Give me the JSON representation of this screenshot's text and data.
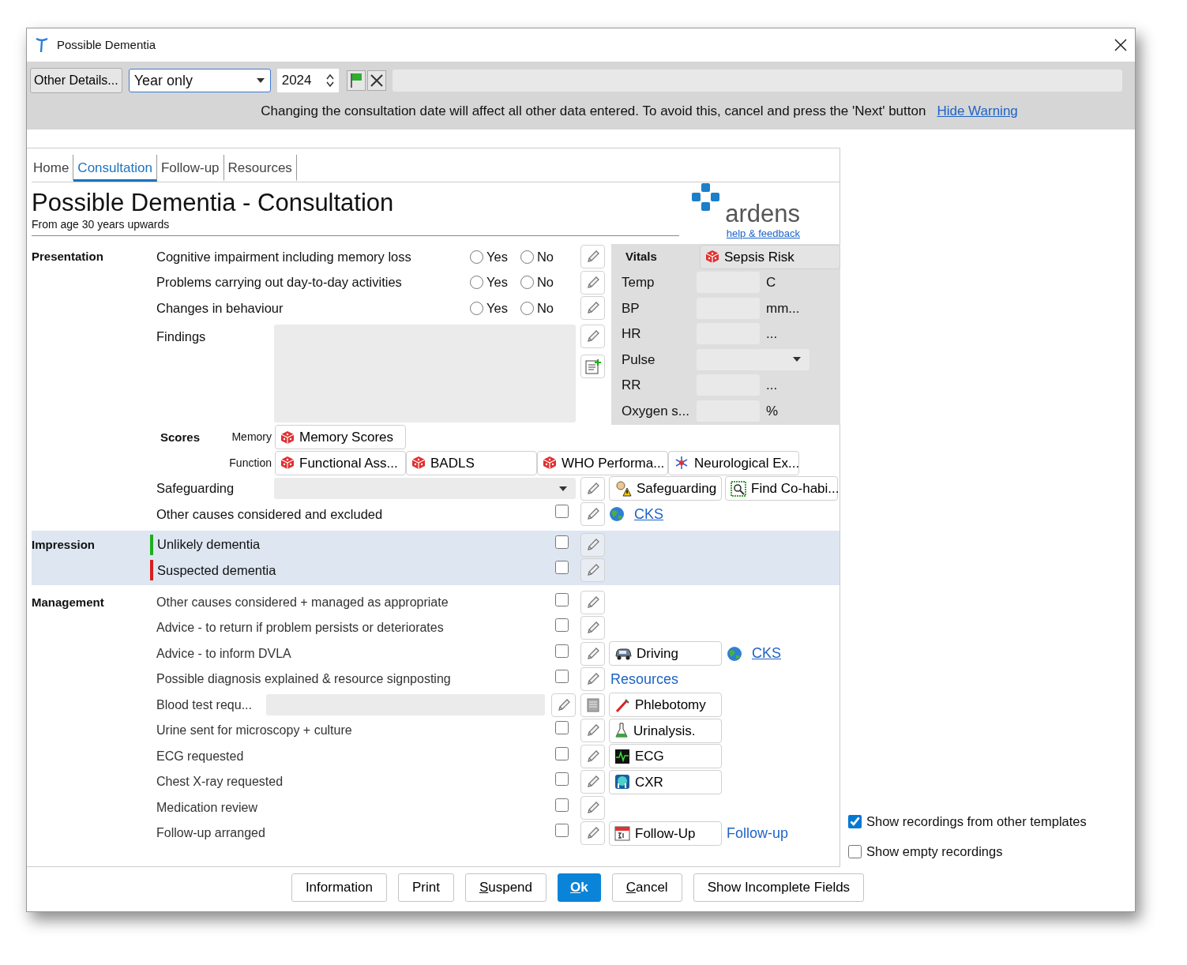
{
  "window": {
    "title": "Possible Dementia"
  },
  "toolbar": {
    "other_details": "Other Details...",
    "date_mode": "Year only",
    "year": "2024"
  },
  "warning": {
    "text": "Changing the consultation date will affect all other data entered. To avoid this, cancel and press the 'Next' button",
    "link": "Hide Warning"
  },
  "tabs": [
    {
      "label": "Home",
      "selected": false
    },
    {
      "label": "Consultation",
      "selected": true
    },
    {
      "label": "Follow-up",
      "selected": false
    },
    {
      "label": "Resources",
      "selected": false
    }
  ],
  "header": {
    "title": "Possible Dementia - Consultation",
    "subtitle": "From age 30 years upwards",
    "logo_text": "ardens",
    "help_link": "help & feedback"
  },
  "presentation": {
    "heading": "Presentation",
    "questions": [
      {
        "label": "Cognitive impairment including memory loss",
        "options": [
          {
            "label": "Yes",
            "selected": false
          },
          {
            "label": "No",
            "selected": false
          }
        ]
      },
      {
        "label": "Problems carrying out day-to-day activities",
        "options": [
          {
            "label": "Yes",
            "selected": false
          },
          {
            "label": "No",
            "selected": false
          }
        ]
      },
      {
        "label": "Changes in behaviour",
        "options": [
          {
            "label": "Yes",
            "selected": false
          },
          {
            "label": "No",
            "selected": false
          }
        ]
      }
    ],
    "findings": {
      "label": "Findings"
    }
  },
  "vitals": {
    "heading": "Vitals",
    "sepsis_button": "Sepsis Risk",
    "rows": [
      {
        "label": "Temp",
        "kind": "field",
        "unit": "C"
      },
      {
        "label": "BP",
        "kind": "field",
        "unit": "mm..."
      },
      {
        "label": "HR",
        "kind": "field",
        "unit": "..."
      },
      {
        "label": "Pulse",
        "kind": "select"
      },
      {
        "label": "RR",
        "kind": "field",
        "unit": "..."
      },
      {
        "label": "Oxygen s...",
        "kind": "field",
        "unit": "%"
      }
    ]
  },
  "scores": {
    "heading": "Scores",
    "groups": [
      {
        "label": "Memory",
        "buttons": [
          "Memory Scores"
        ]
      },
      {
        "label": "Function",
        "buttons": [
          "Functional Ass...",
          "BADLS",
          "WHO Performa...",
          "Neurological Ex..."
        ]
      }
    ]
  },
  "other_rows": [
    {
      "label": "Safeguarding",
      "kind": "select",
      "actions": [
        {
          "kind": "button",
          "label": "Safeguarding"
        },
        {
          "kind": "button",
          "label": "Find Co-habi..."
        }
      ]
    },
    {
      "label": "Other causes considered and excluded",
      "kind": "check",
      "checked": false,
      "actions": [
        {
          "kind": "web-link",
          "label": "CKS"
        }
      ]
    }
  ],
  "impression": {
    "heading": "Impression",
    "rows": [
      {
        "label": "Unlikely dementia",
        "color": "#1fae1f",
        "checked": false
      },
      {
        "label": "Suspected dementia",
        "color": "#d81e1e",
        "checked": false
      }
    ]
  },
  "management": {
    "heading": "Management",
    "rows": [
      {
        "label": "Other causes considered + managed as appropriate",
        "kind": "check",
        "checked": false,
        "actions": []
      },
      {
        "label": "Advice - to return if problem persists or deteriorates",
        "kind": "check",
        "checked": false,
        "actions": []
      },
      {
        "label": "Advice - to inform DVLA",
        "kind": "check",
        "checked": false,
        "actions": [
          {
            "kind": "button",
            "label": "Driving"
          },
          {
            "kind": "web-link",
            "label": "CKS"
          }
        ]
      },
      {
        "label": "Possible diagnosis explained & resource signposting",
        "kind": "check",
        "checked": false,
        "actions": [
          {
            "kind": "link",
            "label": "Resources"
          }
        ]
      },
      {
        "label": "Blood test requ...",
        "kind": "field",
        "actions": [
          {
            "kind": "button",
            "label": "Phlebotomy"
          }
        ]
      },
      {
        "label": "Urine sent for microscopy + culture",
        "kind": "check",
        "checked": false,
        "actions": [
          {
            "kind": "button",
            "label": "Urinalysis."
          }
        ]
      },
      {
        "label": "ECG requested",
        "kind": "check",
        "checked": false,
        "actions": [
          {
            "kind": "button",
            "label": "ECG"
          }
        ]
      },
      {
        "label": "Chest X-ray requested",
        "kind": "check",
        "checked": false,
        "actions": [
          {
            "kind": "button",
            "label": "CXR"
          }
        ]
      },
      {
        "label": "Medication review",
        "kind": "check",
        "checked": false,
        "actions": []
      },
      {
        "label": "Follow-up arranged",
        "kind": "check",
        "checked": false,
        "actions": [
          {
            "kind": "button",
            "label": "Follow-Up"
          },
          {
            "kind": "link",
            "label": "Follow-up"
          }
        ]
      }
    ]
  },
  "options": [
    {
      "label": "Show recordings from other templates",
      "checked": true
    },
    {
      "label": "Show empty recordings",
      "checked": false
    }
  ],
  "buttons": [
    {
      "label": "Information",
      "primary": false
    },
    {
      "label": "Print",
      "primary": false
    },
    {
      "mnemonic": "S",
      "label": "uspend",
      "primary": false
    },
    {
      "mnemonic": "O",
      "label": "k",
      "primary": true
    },
    {
      "mnemonic": "C",
      "label": "ancel",
      "primary": false
    },
    {
      "label": "Show Incomplete Fields",
      "primary": false
    }
  ]
}
